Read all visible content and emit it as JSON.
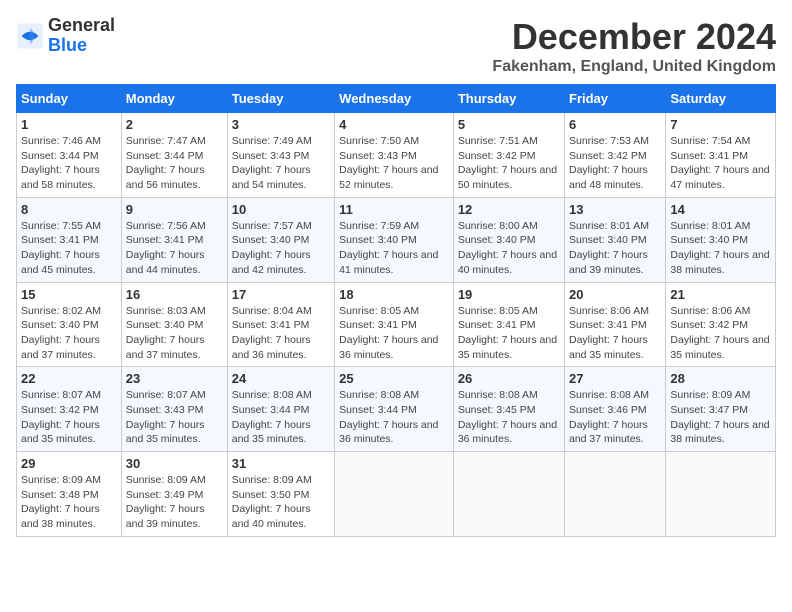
{
  "logo": {
    "text_general": "General",
    "text_blue": "Blue"
  },
  "title": "December 2024",
  "subtitle": "Fakenham, England, United Kingdom",
  "calendar": {
    "headers": [
      "Sunday",
      "Monday",
      "Tuesday",
      "Wednesday",
      "Thursday",
      "Friday",
      "Saturday"
    ],
    "weeks": [
      [
        {
          "day": "1",
          "sunrise": "Sunrise: 7:46 AM",
          "sunset": "Sunset: 3:44 PM",
          "daylight": "Daylight: 7 hours and 58 minutes."
        },
        {
          "day": "2",
          "sunrise": "Sunrise: 7:47 AM",
          "sunset": "Sunset: 3:44 PM",
          "daylight": "Daylight: 7 hours and 56 minutes."
        },
        {
          "day": "3",
          "sunrise": "Sunrise: 7:49 AM",
          "sunset": "Sunset: 3:43 PM",
          "daylight": "Daylight: 7 hours and 54 minutes."
        },
        {
          "day": "4",
          "sunrise": "Sunrise: 7:50 AM",
          "sunset": "Sunset: 3:43 PM",
          "daylight": "Daylight: 7 hours and 52 minutes."
        },
        {
          "day": "5",
          "sunrise": "Sunrise: 7:51 AM",
          "sunset": "Sunset: 3:42 PM",
          "daylight": "Daylight: 7 hours and 50 minutes."
        },
        {
          "day": "6",
          "sunrise": "Sunrise: 7:53 AM",
          "sunset": "Sunset: 3:42 PM",
          "daylight": "Daylight: 7 hours and 48 minutes."
        },
        {
          "day": "7",
          "sunrise": "Sunrise: 7:54 AM",
          "sunset": "Sunset: 3:41 PM",
          "daylight": "Daylight: 7 hours and 47 minutes."
        }
      ],
      [
        {
          "day": "8",
          "sunrise": "Sunrise: 7:55 AM",
          "sunset": "Sunset: 3:41 PM",
          "daylight": "Daylight: 7 hours and 45 minutes."
        },
        {
          "day": "9",
          "sunrise": "Sunrise: 7:56 AM",
          "sunset": "Sunset: 3:41 PM",
          "daylight": "Daylight: 7 hours and 44 minutes."
        },
        {
          "day": "10",
          "sunrise": "Sunrise: 7:57 AM",
          "sunset": "Sunset: 3:40 PM",
          "daylight": "Daylight: 7 hours and 42 minutes."
        },
        {
          "day": "11",
          "sunrise": "Sunrise: 7:59 AM",
          "sunset": "Sunset: 3:40 PM",
          "daylight": "Daylight: 7 hours and 41 minutes."
        },
        {
          "day": "12",
          "sunrise": "Sunrise: 8:00 AM",
          "sunset": "Sunset: 3:40 PM",
          "daylight": "Daylight: 7 hours and 40 minutes."
        },
        {
          "day": "13",
          "sunrise": "Sunrise: 8:01 AM",
          "sunset": "Sunset: 3:40 PM",
          "daylight": "Daylight: 7 hours and 39 minutes."
        },
        {
          "day": "14",
          "sunrise": "Sunrise: 8:01 AM",
          "sunset": "Sunset: 3:40 PM",
          "daylight": "Daylight: 7 hours and 38 minutes."
        }
      ],
      [
        {
          "day": "15",
          "sunrise": "Sunrise: 8:02 AM",
          "sunset": "Sunset: 3:40 PM",
          "daylight": "Daylight: 7 hours and 37 minutes."
        },
        {
          "day": "16",
          "sunrise": "Sunrise: 8:03 AM",
          "sunset": "Sunset: 3:40 PM",
          "daylight": "Daylight: 7 hours and 37 minutes."
        },
        {
          "day": "17",
          "sunrise": "Sunrise: 8:04 AM",
          "sunset": "Sunset: 3:41 PM",
          "daylight": "Daylight: 7 hours and 36 minutes."
        },
        {
          "day": "18",
          "sunrise": "Sunrise: 8:05 AM",
          "sunset": "Sunset: 3:41 PM",
          "daylight": "Daylight: 7 hours and 36 minutes."
        },
        {
          "day": "19",
          "sunrise": "Sunrise: 8:05 AM",
          "sunset": "Sunset: 3:41 PM",
          "daylight": "Daylight: 7 hours and 35 minutes."
        },
        {
          "day": "20",
          "sunrise": "Sunrise: 8:06 AM",
          "sunset": "Sunset: 3:41 PM",
          "daylight": "Daylight: 7 hours and 35 minutes."
        },
        {
          "day": "21",
          "sunrise": "Sunrise: 8:06 AM",
          "sunset": "Sunset: 3:42 PM",
          "daylight": "Daylight: 7 hours and 35 minutes."
        }
      ],
      [
        {
          "day": "22",
          "sunrise": "Sunrise: 8:07 AM",
          "sunset": "Sunset: 3:42 PM",
          "daylight": "Daylight: 7 hours and 35 minutes."
        },
        {
          "day": "23",
          "sunrise": "Sunrise: 8:07 AM",
          "sunset": "Sunset: 3:43 PM",
          "daylight": "Daylight: 7 hours and 35 minutes."
        },
        {
          "day": "24",
          "sunrise": "Sunrise: 8:08 AM",
          "sunset": "Sunset: 3:44 PM",
          "daylight": "Daylight: 7 hours and 35 minutes."
        },
        {
          "day": "25",
          "sunrise": "Sunrise: 8:08 AM",
          "sunset": "Sunset: 3:44 PM",
          "daylight": "Daylight: 7 hours and 36 minutes."
        },
        {
          "day": "26",
          "sunrise": "Sunrise: 8:08 AM",
          "sunset": "Sunset: 3:45 PM",
          "daylight": "Daylight: 7 hours and 36 minutes."
        },
        {
          "day": "27",
          "sunrise": "Sunrise: 8:08 AM",
          "sunset": "Sunset: 3:46 PM",
          "daylight": "Daylight: 7 hours and 37 minutes."
        },
        {
          "day": "28",
          "sunrise": "Sunrise: 8:09 AM",
          "sunset": "Sunset: 3:47 PM",
          "daylight": "Daylight: 7 hours and 38 minutes."
        }
      ],
      [
        {
          "day": "29",
          "sunrise": "Sunrise: 8:09 AM",
          "sunset": "Sunset: 3:48 PM",
          "daylight": "Daylight: 7 hours and 38 minutes."
        },
        {
          "day": "30",
          "sunrise": "Sunrise: 8:09 AM",
          "sunset": "Sunset: 3:49 PM",
          "daylight": "Daylight: 7 hours and 39 minutes."
        },
        {
          "day": "31",
          "sunrise": "Sunrise: 8:09 AM",
          "sunset": "Sunset: 3:50 PM",
          "daylight": "Daylight: 7 hours and 40 minutes."
        },
        null,
        null,
        null,
        null
      ]
    ]
  },
  "colors": {
    "header_bg": "#1a73e8",
    "header_text": "#ffffff",
    "border": "#cccccc",
    "row_even": "#f5f8ff"
  }
}
